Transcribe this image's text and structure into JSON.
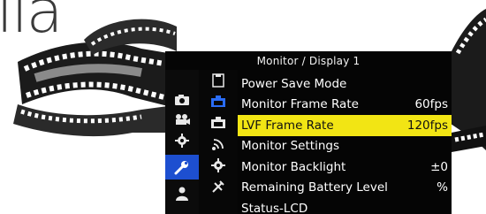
{
  "background_fragment": "ila",
  "menu": {
    "title": "Monitor / Display 1",
    "left_tabs": [
      {
        "icon": "camera-icon",
        "active": false
      },
      {
        "icon": "video-camera-icon",
        "active": false
      },
      {
        "icon": "gear-icon",
        "active": false
      },
      {
        "icon": "wrench-icon",
        "active": true
      },
      {
        "icon": "person-icon",
        "active": false
      }
    ],
    "sub_tabs": [
      {
        "icon": "page-icon"
      },
      {
        "icon": "monitor-icon",
        "active": true
      },
      {
        "icon": "monitor-alt-icon"
      },
      {
        "icon": "wireless-icon"
      },
      {
        "icon": "gear-small-icon"
      },
      {
        "icon": "tools-icon"
      }
    ],
    "items": [
      {
        "label": "Power Save Mode",
        "value": ""
      },
      {
        "label": "Monitor Frame Rate",
        "value": "60fps"
      },
      {
        "label": "LVF Frame Rate",
        "value": "120fps",
        "selected": true
      },
      {
        "label": "Monitor Settings",
        "value": ""
      },
      {
        "label": "Monitor Backlight",
        "value": "±0"
      },
      {
        "label": "Remaining Battery Level",
        "value": "%"
      },
      {
        "label": "Status-LCD",
        "value": ""
      }
    ]
  },
  "colors": {
    "highlight": "#f2e514",
    "active_tab": "#1d4fd0",
    "accent_blue": "#2a6cf5"
  }
}
